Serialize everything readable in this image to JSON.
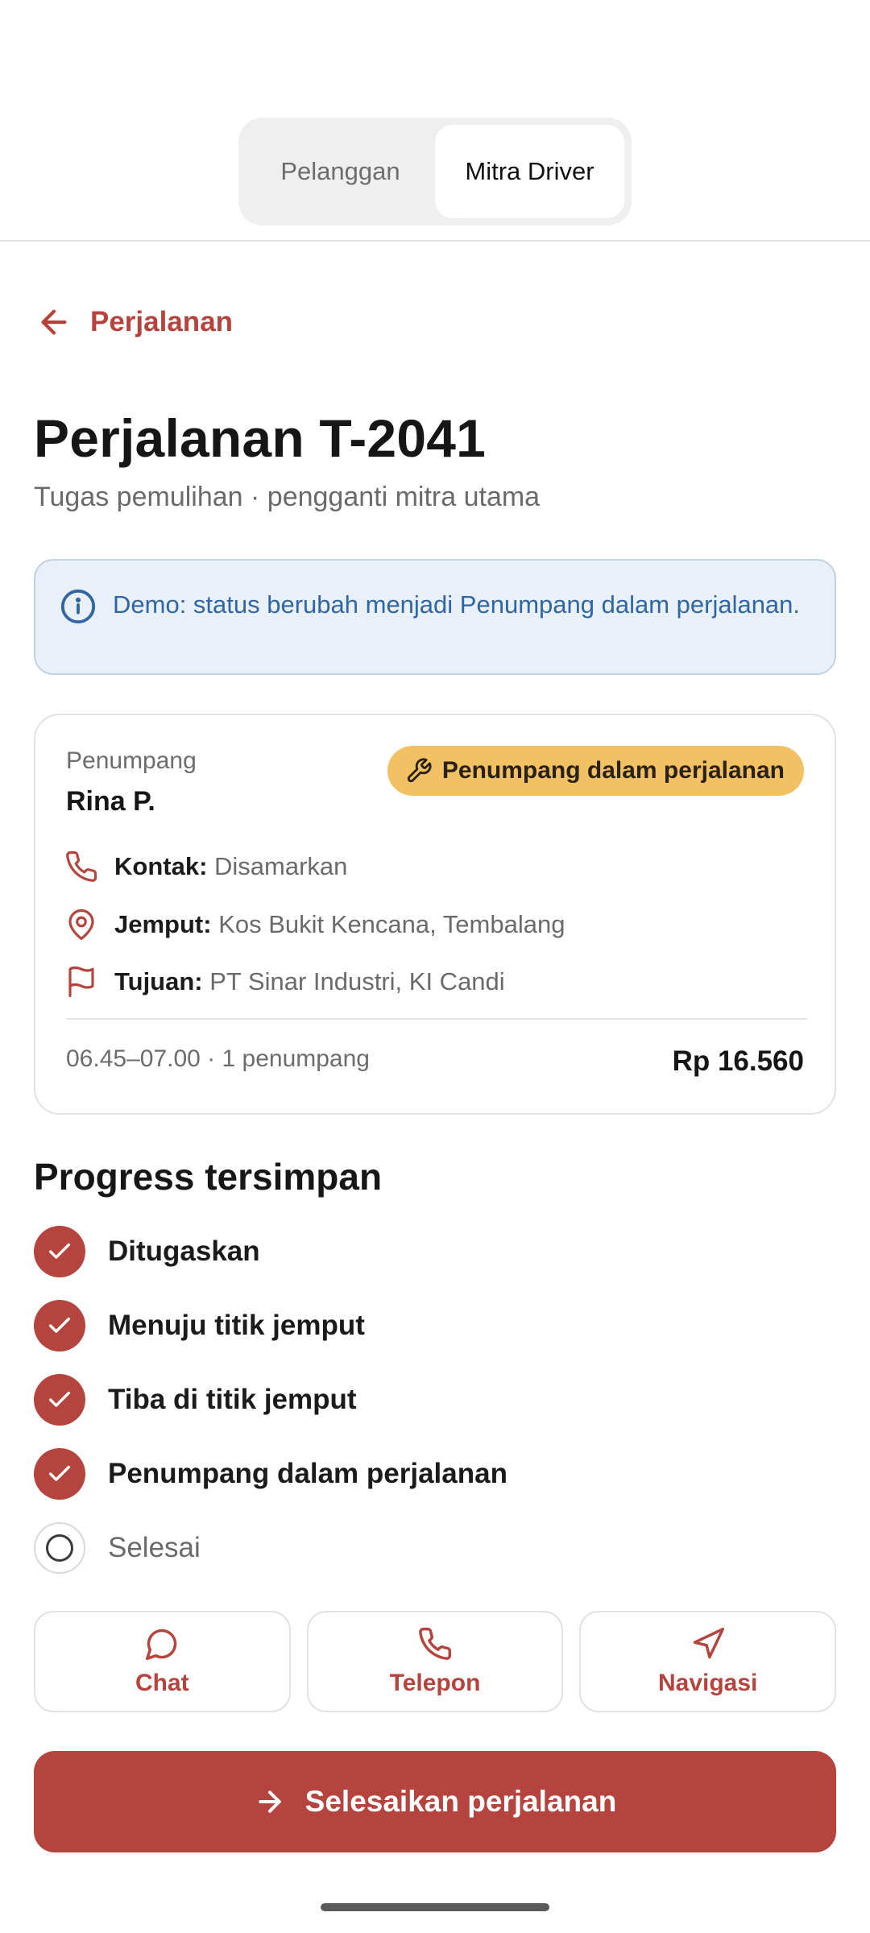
{
  "segment": {
    "options": [
      "Pelanggan",
      "Mitra Driver"
    ],
    "selected": "Mitra Driver"
  },
  "nav": {
    "back_label": "Perjalanan"
  },
  "header": {
    "title": "Perjalanan T-2041",
    "subtitle": "Tugas pemulihan · pengganti mitra utama"
  },
  "info_banner": {
    "icon": "info-icon",
    "text": "Demo: status berubah menjadi Penumpang dalam perjalanan."
  },
  "trip_card": {
    "passenger_label": "Penumpang",
    "passenger_name": "Rina P.",
    "status_badge": "Penumpang dalam perjalanan",
    "status_color": "#f2c163",
    "contact_label": "Kontak:",
    "contact_value": "Disamarkan",
    "pickup_label": "Jemput:",
    "pickup_value": "Kos Bukit Kencana, Tembalang",
    "dest_label": "Tujuan:",
    "dest_value": "PT Sinar Industri, KI Candi",
    "schedule": "06.45–07.00 · 1 penumpang",
    "price": "Rp 16.560"
  },
  "progress": {
    "title": "Progress tersimpan",
    "steps": [
      {
        "label": "Ditugaskan",
        "done": true
      },
      {
        "label": "Menuju titik jemput",
        "done": true
      },
      {
        "label": "Tiba di titik jemput",
        "done": true
      },
      {
        "label": "Penumpang dalam perjalanan",
        "done": true
      },
      {
        "label": "Selesai",
        "done": false
      }
    ]
  },
  "actions": {
    "chat": "Chat",
    "phone": "Telepon",
    "navigate": "Navigasi"
  },
  "primary_action": "Selesaikan perjalanan",
  "colors": {
    "accent": "#b4443d",
    "info_bg": "#e9f0f8",
    "info_text": "#2f66a3",
    "badge": "#f2c163"
  }
}
